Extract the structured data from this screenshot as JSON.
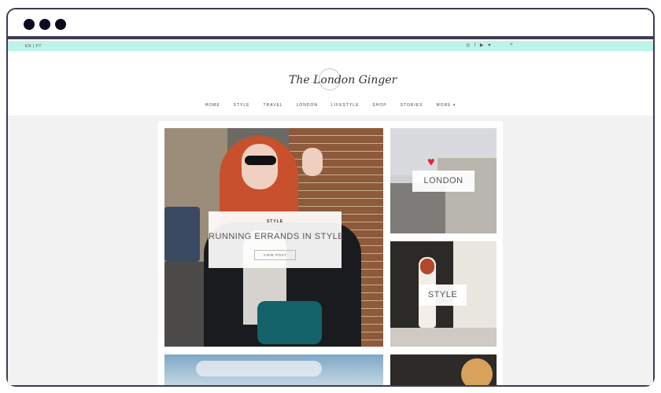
{
  "topbar": {
    "language": "EN | PT",
    "social_icons": [
      "instagram-icon",
      "facebook-icon",
      "youtube-icon",
      "twitter-icon"
    ],
    "search_icon": "search-icon"
  },
  "header": {
    "logo_text": "The London Ginger",
    "nav": [
      "HOME",
      "STYLE",
      "TRAVEL",
      "LONDON",
      "LIFESTYLE",
      "SHOP",
      "STORIES",
      "MORE ▾"
    ]
  },
  "featured": {
    "category": "STYLE",
    "title": "RUNNING ERRANDS IN STYLE",
    "button": "VIEW POST"
  },
  "tiles": {
    "london": "LONDON",
    "style": "STYLE"
  },
  "colors": {
    "topbar_bg": "#bdf3ea",
    "frame": "#3d3b52",
    "heart": "#e0272d"
  }
}
